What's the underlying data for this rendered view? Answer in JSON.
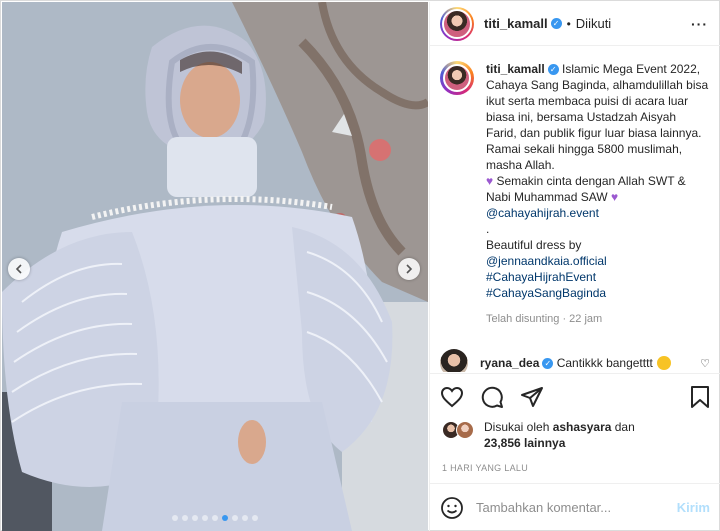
{
  "post": {
    "username": "titi_kamall",
    "follow_status": "Diikuti",
    "separator": "•",
    "more_icon": "more-horizontal-icon"
  },
  "caption": {
    "username": "titi_kamall",
    "line1": "Islamic Mega Event 2022, Cahaya Sang Baginda, alhamdulillah bisa ikut serta membaca puisi di acara luar biasa ini, bersama Ustadzah Aisyah Farid, dan publik figur luar biasa lainnya. Ramai sekali hingga 5800 muslimah, masha Allah.",
    "line2": " Semakin cinta dengan Allah SWT & Nabi Muhammad SAW ",
    "mention1": "@cahayahijrah.event",
    "dot": ".",
    "line3": "Beautiful dress by",
    "mention2": "@jennaandkaia.official",
    "tag1": "#CahayaHijrahEvent",
    "tag2": "#CahayaSangBaginda",
    "meta": "Telah disunting · 22 jam"
  },
  "comment": {
    "username": "ryana_dea",
    "text": "Cantikkk bangetttt"
  },
  "likes": {
    "prefix": "Disukai oleh ",
    "user": "ashasyara",
    "mid": " dan",
    "count": "23,856 lainnya"
  },
  "date": "1 HARI YANG LALU",
  "add_comment": {
    "placeholder": "Tambahkan komentar...",
    "post_label": "Kirim"
  },
  "carousel": {
    "total_slides": 9,
    "active_index": 5
  },
  "colors": {
    "accent_blue": "#3897f0",
    "link": "#00376b",
    "muted": "#8e8e8e",
    "post_disabled": "#b2dffc"
  }
}
